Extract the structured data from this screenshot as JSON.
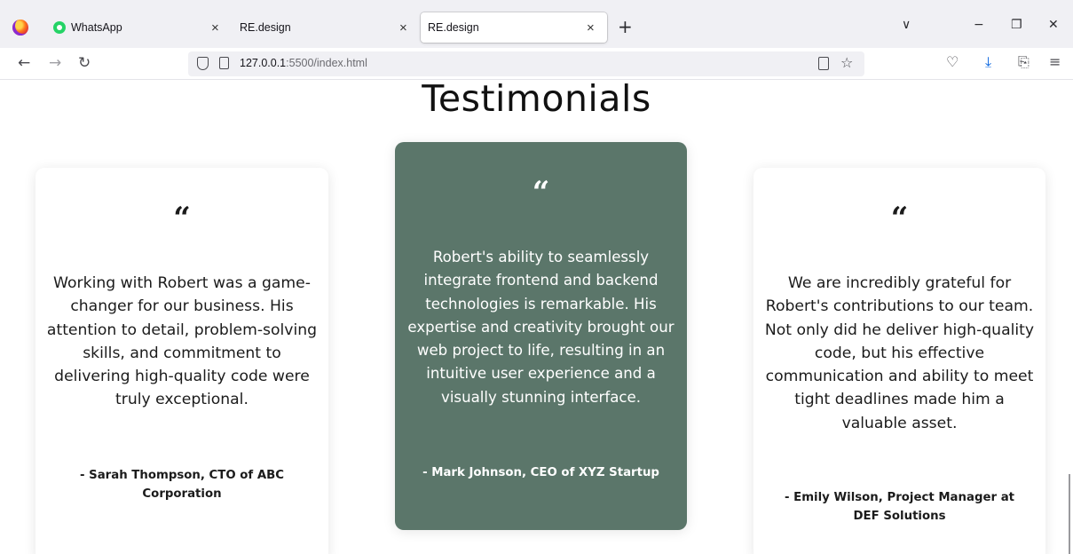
{
  "browser": {
    "tabs": [
      {
        "title": "WhatsApp",
        "active": false
      },
      {
        "title": "RE.design",
        "active": false
      },
      {
        "title": "RE.design",
        "active": true
      }
    ],
    "tab_close_glyph": "×",
    "new_tab_glyph": "+",
    "url_host": "127.0.0.1",
    "url_path": ":5500/index.html",
    "window_controls": {
      "list_all_tabs": "∨",
      "minimize": "−",
      "restore": "❐",
      "close": "✕"
    }
  },
  "page": {
    "title": "Testimonials",
    "quote_glyph": "“",
    "testimonials": [
      {
        "text": "Working with Robert was a game-changer for our business. His attention to detail, problem-solving skills, and commitment to delivering high-quality code were truly exceptional.",
        "author": "- Sarah Thompson, CTO of ABC Corporation",
        "highlighted": false
      },
      {
        "text": "Robert's ability to seamlessly integrate frontend and backend technologies is remarkable. His expertise and creativity brought our web project to life, resulting in an intuitive user experience and a visually stunning interface.",
        "author": "- Mark Johnson, CEO of XYZ Startup",
        "highlighted": true
      },
      {
        "text": "We are incredibly grateful for Robert's contributions to our team. Not only did he deliver high-quality code, but his effective communication and ability to meet tight deadlines made him a valuable asset.",
        "author": "- Emily Wilson, Project Manager at DEF Solutions",
        "highlighted": false
      }
    ]
  },
  "colors": {
    "highlight_card": "#5b766a",
    "card_bg": "#ffffff",
    "text": "#111111"
  }
}
